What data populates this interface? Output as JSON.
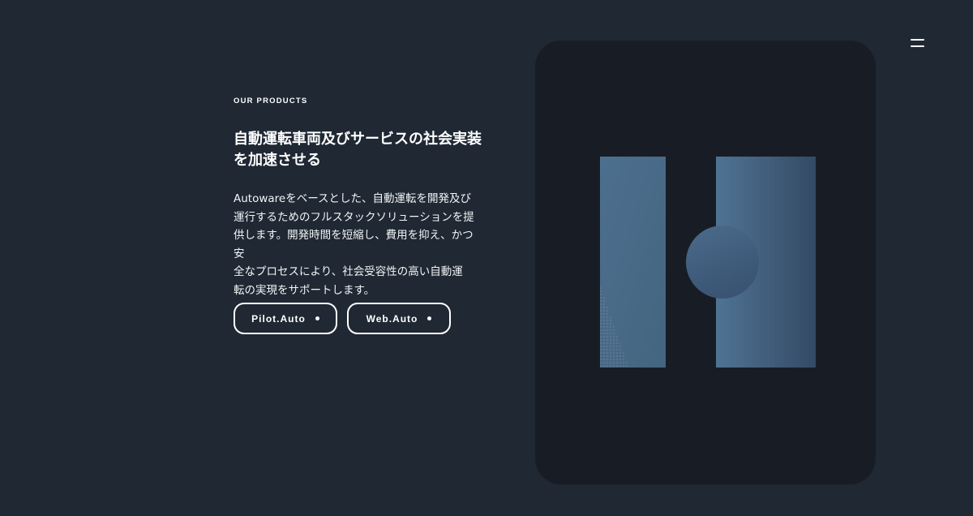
{
  "section": {
    "eyebrow": "OUR PRODUCTS",
    "headline_line1": "自動運転車両及びサービスの社会実装",
    "headline_line2": "を加速させる",
    "description_lines": [
      "Autowareをベースとした、自動運転を開発及び",
      "運行するためのフルスタックソリューションを提",
      "供します。開発時間を短縮し、費用を抑え、かつ安",
      "全なプロセスにより、社会受容性の高い自動運",
      "転の実現をサポートします。"
    ]
  },
  "buttons": {
    "pilot_label": "Pilot.Auto",
    "web_label": "Web.Auto"
  },
  "icons": {
    "menu": "hamburger-menu-icon",
    "button_marker": "dot-icon"
  },
  "colors": {
    "background": "#1f2833",
    "card": "#181d25",
    "accent_blue": "#4a6a88",
    "text": "#ffffff"
  }
}
